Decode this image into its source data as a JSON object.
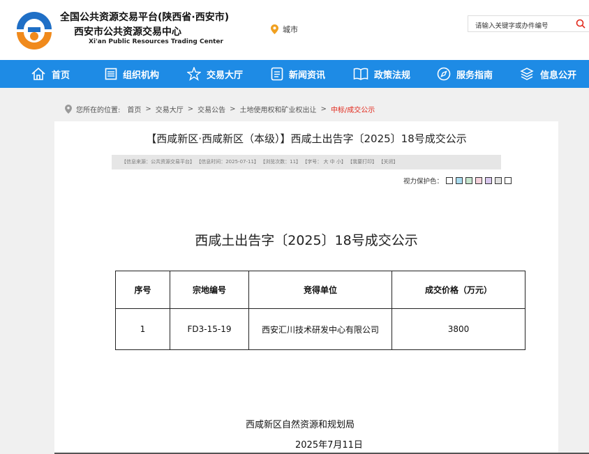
{
  "header": {
    "title": "全国公共资源交易平台(陕西省·西安市)",
    "subtitle": "西安市公共资源交易中心",
    "english_name": "Xi'an Public Resources Trading Center",
    "city_label": "城市",
    "search_placeholder": "请输入关键字或办件编号"
  },
  "colors": {
    "nav_bg": "#1e8be5",
    "logo_blue": "#1f6fc6",
    "logo_orange": "#f08a1c",
    "breadcrumb_current": "#e2281b"
  },
  "nav": {
    "items": [
      {
        "label": "首页",
        "icon": "home-icon"
      },
      {
        "label": "组织机构",
        "icon": "org-icon"
      },
      {
        "label": "交易大厅",
        "icon": "star-icon"
      },
      {
        "label": "新闻资讯",
        "icon": "news-icon"
      },
      {
        "label": "政策法规",
        "icon": "book-icon"
      },
      {
        "label": "服务指南",
        "icon": "compass-icon"
      },
      {
        "label": "信息公开",
        "icon": "info-icon"
      }
    ]
  },
  "breadcrumb": {
    "prefix": "您所在的位置:",
    "items": [
      "首页",
      "交易大厅",
      "交易公告",
      "土地使用权和矿业权出让"
    ],
    "current": "中标/成交公示"
  },
  "article": {
    "title": "【西咸新区·西咸新区（本级）】西咸土出告字〔2025〕18号成交公示",
    "meta": "【信息来源：公共资源交易平台】 【信息时间：2025-07-11】 【浏览次数：11】 【字号： 大 中 小】 【我要打印】 【关闭】",
    "eye_care_label": "视力保护色：",
    "eye_care_colors": [
      "#ffffff",
      "#a9dcef",
      "#c7e6cf",
      "#f5d2dc",
      "#d9c8ee",
      "#e0e0e0",
      "#ffffff"
    ],
    "doc_title": "西咸土出告字〔2025〕18号成交公示",
    "table": {
      "headers": [
        "序号",
        "宗地编号",
        "竞得单位",
        "成交价格（万元）"
      ],
      "rows": [
        [
          "1",
          "FD3-15-19",
          "西安汇川技术研发中心有限公司",
          "3800"
        ]
      ]
    },
    "signature_org": "西咸新区自然资源和规划局",
    "signature_date": "2025年7月11日"
  }
}
